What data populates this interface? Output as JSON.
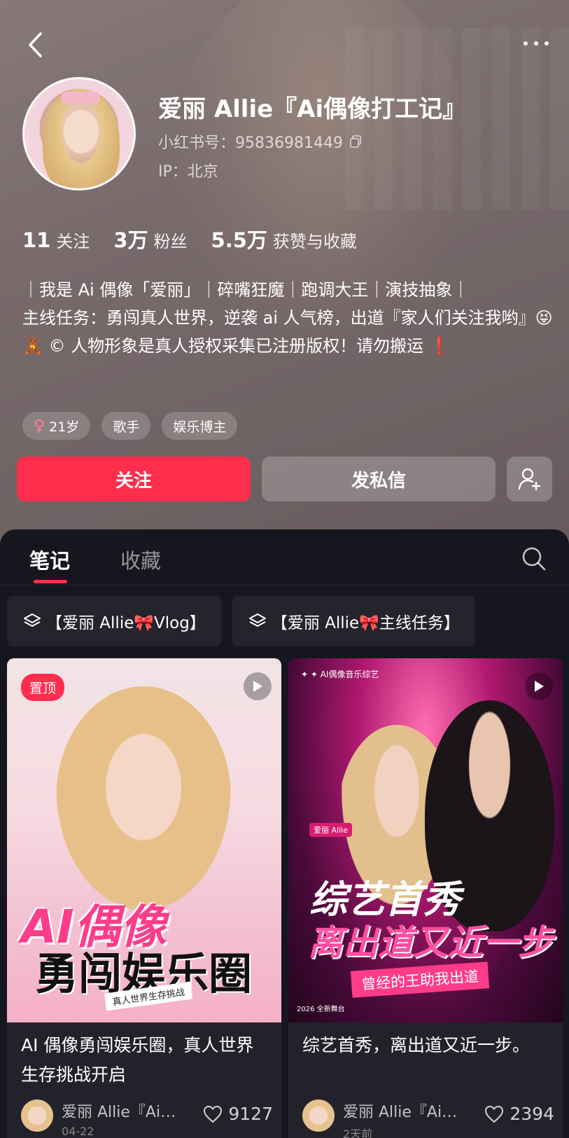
{
  "profile": {
    "name": "爱丽 Allie『Ai偶像打工记』",
    "red_id": "小红书号：95836981449",
    "ip": "IP：北京",
    "stats": [
      {
        "value": "11",
        "label": "关注"
      },
      {
        "value": "3万",
        "label": "粉丝"
      },
      {
        "value": "5.5万",
        "label": "获赞与收藏"
      }
    ],
    "bio": [
      "｜我是 Ai 偶像「爱丽」｜碎嘴狂魔｜跑调大王｜演技抽象｜",
      "主线任务：勇闯真人世界，逆袭 ai 人气榜，出道『家人们关注我哟』😝",
      "🧸 © 人物形象是真人授权采集已注册版权！请勿搬运 ❗"
    ],
    "tags": [
      "21岁",
      "歌手",
      "娱乐博主"
    ]
  },
  "actions": {
    "follow": "关注",
    "message": "发私信"
  },
  "tabs": {
    "notes": "笔记",
    "collections": "收藏"
  },
  "collections": [
    "【爱丽 Allie🎀Vlog】",
    "【爱丽 Allie🎀主线任务】"
  ],
  "notes": [
    {
      "pinned_label": "置顶",
      "cover_text": {
        "line1": "AI偶像",
        "line2": "勇闯娱乐圈",
        "sub": "真人世界生存挑战"
      },
      "title": "AI 偶像勇闯娱乐圈，真人世界生存挑战开启",
      "author": "爱丽 Allie『Ai…",
      "date": "04-22",
      "likes": "9127"
    },
    {
      "cover_text": {
        "top": "✦ ✦ AI偶像音乐综艺",
        "name": "爱丽 Allie",
        "line1": "综艺首秀",
        "line2": "离出道又近一步",
        "sub": "曾经的王助我出道",
        "stage": "2026 全新舞台"
      },
      "title": "综艺首秀，离出道又近一步。",
      "author": "爱丽 Allie『Ai…",
      "date": "2天前",
      "likes": "2394"
    }
  ],
  "colors": {
    "accent": "#ff2e4d",
    "panel_bg": "#16161e"
  }
}
